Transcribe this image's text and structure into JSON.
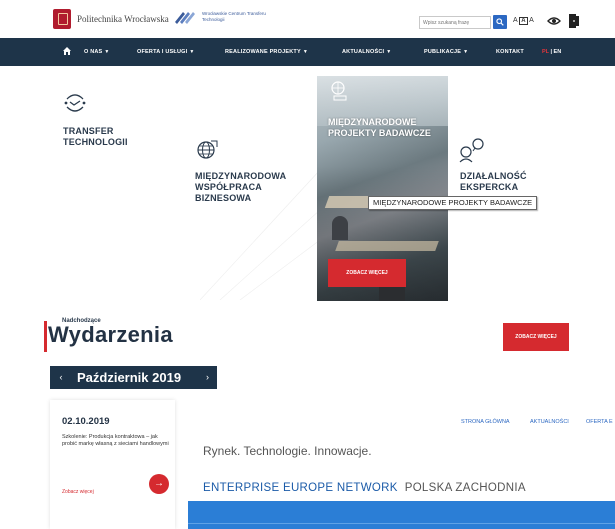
{
  "header": {
    "university_name": "Politechnika Wrocławska",
    "center_name": "Wrocławskie Centrum Transferu Technologii",
    "search_placeholder": "Wpisz szukaną frazę",
    "font_size_label_small": "A",
    "font_size_label_box": "A",
    "font_size_label_large": "A"
  },
  "nav": {
    "items": [
      {
        "label": "O NAS",
        "dropdown": true
      },
      {
        "label": "OFERTA I USŁUGI",
        "dropdown": true
      },
      {
        "label": "REALIZOWANE PROJEKTY",
        "dropdown": true
      },
      {
        "label": "AKTUALNOŚCI",
        "dropdown": true
      },
      {
        "label": "PUBLIKACJE",
        "dropdown": true
      },
      {
        "label": "KONTAKT",
        "dropdown": false
      }
    ],
    "caret": "▼",
    "lang_pl": "PL",
    "lang_sep": " | ",
    "lang_en": "EN"
  },
  "tiles": {
    "transfer": "TRANSFER TECHNOLOGII",
    "international": "MIĘDZYNARODOWA WSPÓŁPRACA BIZNESOWA",
    "featured_title": "MIĘDZYNARODOWE PROJEKTY BADAWCZE",
    "featured_button": "ZOBACZ WIĘCEJ",
    "expert": "DZIAŁALNOŚĆ EKSPERCKA",
    "tooltip": "MIĘDZYNARODOWE PROJEKTY BADAWCZE"
  },
  "events": {
    "subtitle": "Nadchodzące",
    "title": "Wydarzenia",
    "more_button": "ZOBACZ WIĘCEJ",
    "month": "Październik 2019",
    "prev": "‹",
    "next": "›",
    "card": {
      "date": "02.10.2019",
      "description": "Szkolenie: Produkcja kontraktowa – jak probić markę własną z sieciami handlowymi",
      "more_link": "Zobacz więcej",
      "arrow": "→"
    }
  },
  "een": {
    "breadcrumbs": [
      "STRONA GŁÓWNA",
      "AKTUALNOŚCI",
      "OFERTA E"
    ],
    "tagline": "Rynek. Technologie. Innowacje.",
    "heading_primary": "ENTERPRISE EUROPE NETWORK",
    "heading_secondary": "POLSKA ZACHODNIA"
  },
  "colors": {
    "nav_bg": "#1e3449",
    "accent_red": "#d52a2f",
    "link_blue": "#2c68c2",
    "een_blue": "#2b7ed6"
  }
}
